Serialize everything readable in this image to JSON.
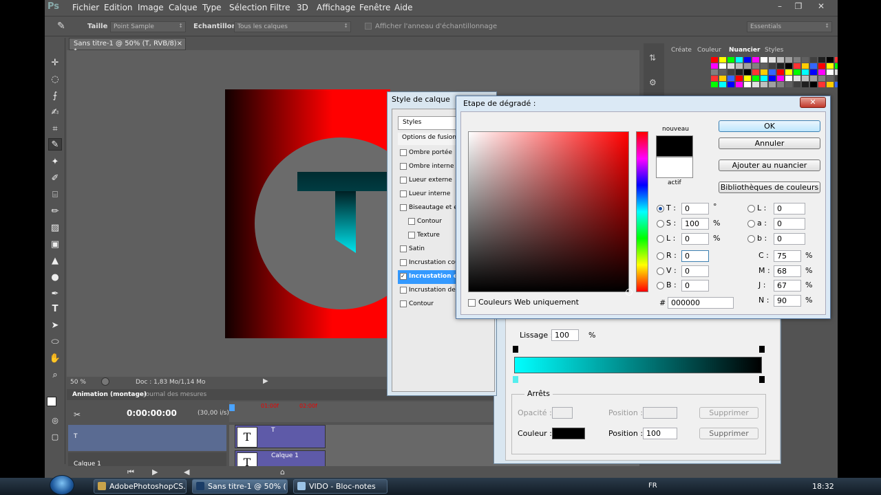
{
  "menubar": {
    "logo": "Ps",
    "items": [
      "Fichier",
      "Edition",
      "Image",
      "Calque",
      "Type",
      "Sélection",
      "Filtre",
      "3D",
      "Affichage",
      "Fenêtre",
      "Aide"
    ]
  },
  "options": {
    "size_label": "Taille :",
    "size_value": "Point Sample",
    "sample_label": "Echantillon :",
    "sample_value": "Tous les calques",
    "ring_label": "Afficher l'anneau d'échantillonnage",
    "workspace": "Essentials"
  },
  "document": {
    "tab_title": "Sans titre-1 @ 50% (T, RVB/8) *",
    "close": "×",
    "zoom": "50 %",
    "doc_info": "Doc : 1,83 Mo/1,14 Mo",
    "canvas_letter": "T"
  },
  "panels": {
    "tabs": [
      "Créate",
      "Couleur",
      "Nuancier",
      "Styles"
    ],
    "active_tab": "Nuancier"
  },
  "animation": {
    "tab_active": "Animation (montage)",
    "tab_other": "Journal des mesures",
    "time": "0:00:00:00",
    "fps": "(30,00 i/s)",
    "markers": [
      "01:00f",
      "02:00f"
    ],
    "layers": [
      {
        "name": "T",
        "clip_label": "T"
      },
      {
        "name": "Calque 1",
        "clip_label": "Calque 1"
      }
    ]
  },
  "style_dialog": {
    "title": "Style de calque",
    "header": "Styles",
    "fusion": "Options de fusion : ...",
    "items": [
      {
        "label": "Ombre portée",
        "checked": false,
        "indent": false
      },
      {
        "label": "Ombre interne",
        "checked": false,
        "indent": false
      },
      {
        "label": "Lueur externe",
        "checked": false,
        "indent": false
      },
      {
        "label": "Lueur interne",
        "checked": false,
        "indent": false
      },
      {
        "label": "Biseautage et estampage",
        "checked": false,
        "indent": false
      },
      {
        "label": "Contour",
        "checked": false,
        "indent": true
      },
      {
        "label": "Texture",
        "checked": false,
        "indent": true
      },
      {
        "label": "Satin",
        "checked": false,
        "indent": false
      },
      {
        "label": "Incrustation couleur",
        "checked": false,
        "indent": false
      },
      {
        "label": "Incrustation en dégradé",
        "checked": true,
        "indent": false
      },
      {
        "label": "Incrustation de motif",
        "checked": false,
        "indent": false
      },
      {
        "label": "Contour",
        "checked": false,
        "indent": false
      }
    ]
  },
  "gradient_editor": {
    "smoothing_label": "Lissage :",
    "smoothing_value": "100",
    "percent": "%",
    "stops_label": "Arrêts",
    "opacity_label": "Opacité :",
    "position_label": "Position :",
    "color_label": "Couleur :",
    "position_value": "100",
    "delete": "Supprimer"
  },
  "picker": {
    "title": "Etape de dégradé :",
    "close": "✕",
    "new_label": "nouveau",
    "current_label": "actif",
    "web_only": "Couleurs Web uniquement",
    "buttons": {
      "ok": "OK",
      "cancel": "Annuler",
      "add_swatch": "Ajouter au nuancier",
      "libraries": "Bibliothèques de couleurs"
    },
    "hsb": [
      {
        "label": "T :",
        "value": "0",
        "unit": "°",
        "selected": true
      },
      {
        "label": "S :",
        "value": "100",
        "unit": "%",
        "selected": false
      },
      {
        "label": "L :",
        "value": "0",
        "unit": "%",
        "selected": false
      }
    ],
    "rgb": [
      {
        "label": "R :",
        "value": "0"
      },
      {
        "label": "V :",
        "value": "0"
      },
      {
        "label": "B :",
        "value": "0"
      }
    ],
    "lab": [
      {
        "label": "L :",
        "value": "0"
      },
      {
        "label": "a :",
        "value": "0"
      },
      {
        "label": "b :",
        "value": "0"
      }
    ],
    "cmyk": [
      {
        "label": "C :",
        "value": "75",
        "unit": "%"
      },
      {
        "label": "M :",
        "value": "68",
        "unit": "%"
      },
      {
        "label": "J :",
        "value": "67",
        "unit": "%"
      },
      {
        "label": "N :",
        "value": "90",
        "unit": "%"
      }
    ],
    "hex_label": "#",
    "hex_value": "000000"
  },
  "taskbar": {
    "items": [
      "AdobePhotoshopCS...",
      "Sans titre-1 @ 50% (...",
      "VIDO - Bloc-notes"
    ],
    "lang": "FR",
    "clock": "18:32"
  },
  "colors": {
    "cyan": "#00e5ee",
    "red": "#ff0000",
    "ps_gray": "#535353"
  }
}
